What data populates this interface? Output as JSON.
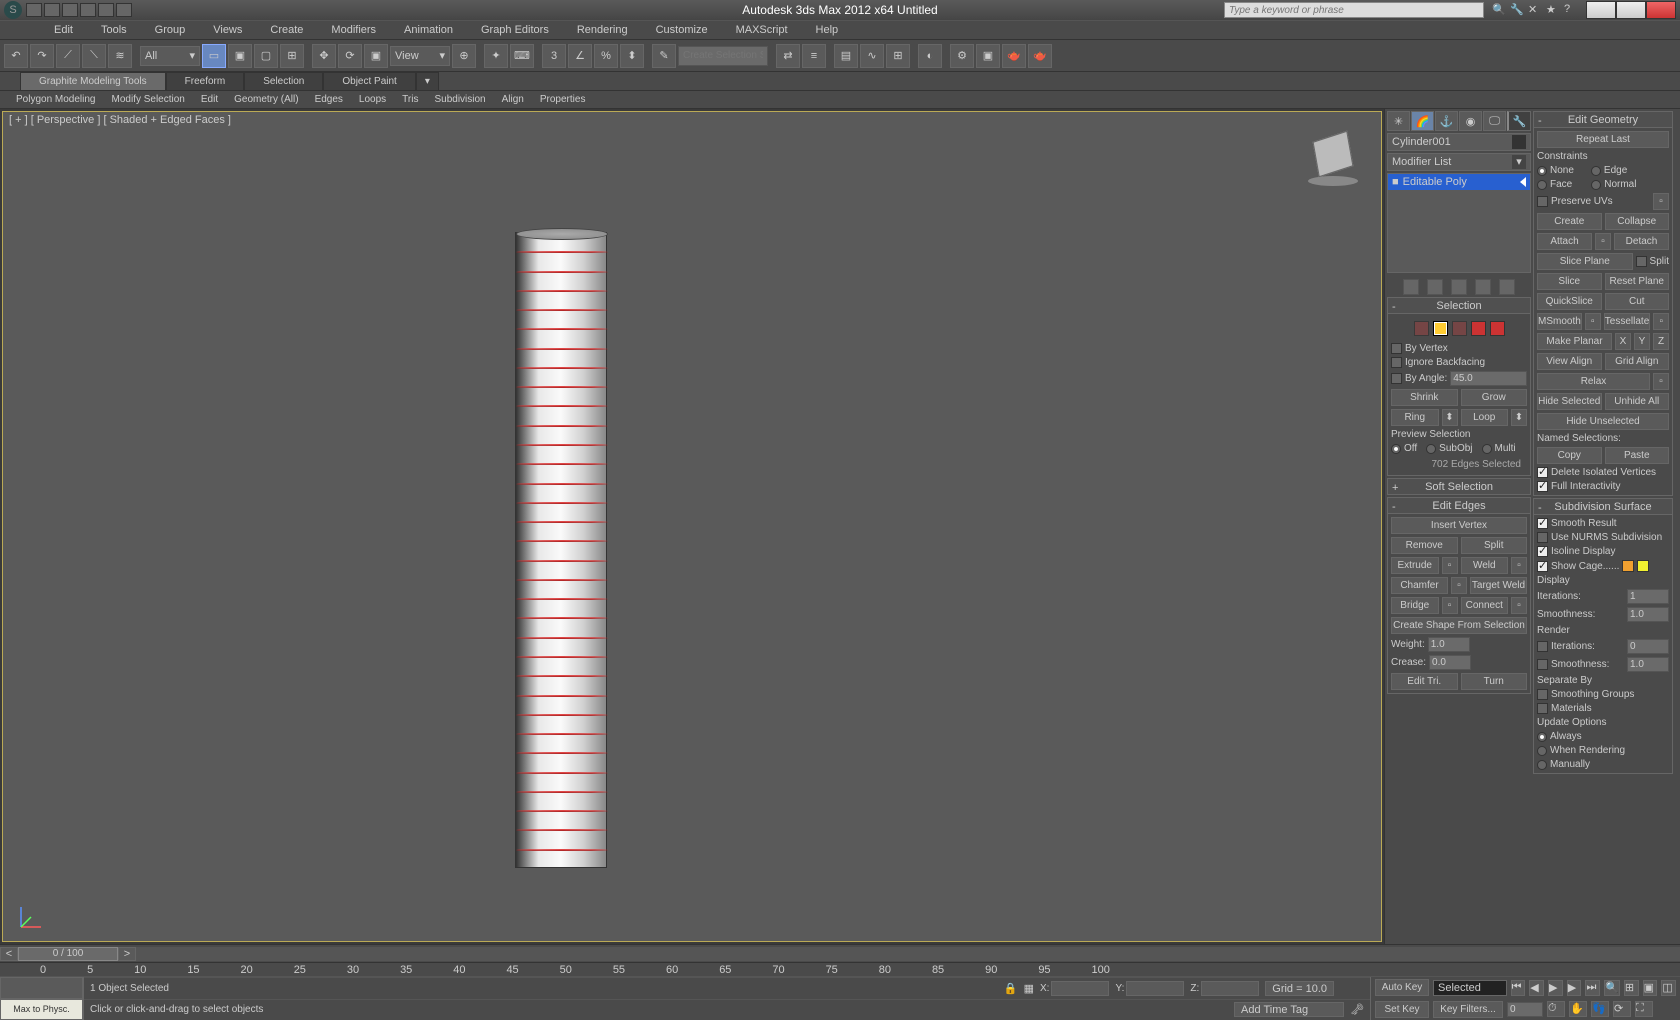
{
  "title": "Autodesk 3ds Max 2012 x64     Untitled",
  "search_placeholder": "Type a keyword or phrase",
  "menu": [
    "Edit",
    "Tools",
    "Group",
    "Views",
    "Create",
    "Modifiers",
    "Animation",
    "Graph Editors",
    "Rendering",
    "Customize",
    "MAXScript",
    "Help"
  ],
  "toolbar": {
    "filter_dd": "All",
    "view_dd": "View",
    "create_sel": "Create Selection Se"
  },
  "ribbon_tabs": [
    "Graphite Modeling Tools",
    "Freeform",
    "Selection",
    "Object Paint"
  ],
  "ribbon_sub": [
    "Polygon Modeling",
    "Modify Selection",
    "Edit",
    "Geometry (All)",
    "Edges",
    "Loops",
    "Tris",
    "Subdivision",
    "Align",
    "Properties"
  ],
  "viewport_label": "[ + ] [ Perspective ] [ Shaded + Edged Faces ]",
  "object_name": "Cylinder001",
  "modifier_list_label": "Modifier List",
  "modifier_stack_item": "Editable Poly",
  "selection": {
    "header": "Selection",
    "by_vertex": "By Vertex",
    "ignore_backfacing": "Ignore Backfacing",
    "by_angle": "By Angle:",
    "by_angle_val": "45.0",
    "shrink": "Shrink",
    "grow": "Grow",
    "ring": "Ring",
    "loop": "Loop",
    "preview": "Preview Selection",
    "off": "Off",
    "subobj": "SubObj",
    "multi": "Multi",
    "status": "702 Edges Selected"
  },
  "soft_sel_header": "Soft Selection",
  "edit_edges": {
    "header": "Edit Edges",
    "insert_vertex": "Insert Vertex",
    "remove": "Remove",
    "split": "Split",
    "extrude": "Extrude",
    "weld": "Weld",
    "chamfer": "Chamfer",
    "target_weld": "Target Weld",
    "bridge": "Bridge",
    "connect": "Connect",
    "create_shape": "Create Shape From Selection",
    "weight": "Weight:",
    "weight_val": "1.0",
    "crease": "Crease:",
    "crease_val": "0.0",
    "edit_tri": "Edit Tri.",
    "turn": "Turn"
  },
  "edit_geom": {
    "header": "Edit Geometry",
    "repeat": "Repeat Last",
    "constraints": "Constraints",
    "none": "None",
    "edge": "Edge",
    "face": "Face",
    "normal": "Normal",
    "preserve_uvs": "Preserve UVs",
    "create": "Create",
    "collapse": "Collapse",
    "attach": "Attach",
    "detach": "Detach",
    "slice_plane": "Slice Plane",
    "split": "Split",
    "slice": "Slice",
    "reset_plane": "Reset Plane",
    "quickslice": "QuickSlice",
    "cut": "Cut",
    "msmooth": "MSmooth",
    "tessellate": "Tessellate",
    "make_planar": "Make Planar",
    "x": "X",
    "y": "Y",
    "z": "Z",
    "view_align": "View Align",
    "grid_align": "Grid Align",
    "relax": "Relax",
    "hide_sel": "Hide Selected",
    "unhide_all": "Unhide All",
    "hide_unsel": "Hide Unselected",
    "named_sel": "Named Selections:",
    "copy": "Copy",
    "paste": "Paste",
    "del_iso": "Delete Isolated Vertices",
    "full_int": "Full Interactivity"
  },
  "subdiv": {
    "header": "Subdivision Surface",
    "smooth": "Smooth Result",
    "nurms": "Use NURMS Subdivision",
    "isoline": "Isoline Display",
    "show_cage": "Show Cage......",
    "display": "Display",
    "iterations": "Iterations:",
    "iter_val": "1",
    "smoothness": "Smoothness:",
    "smooth_val": "1.0",
    "render": "Render",
    "r_iter_val": "0",
    "r_smooth_val": "1.0",
    "separate": "Separate By",
    "smoothing_groups": "Smoothing Groups",
    "materials": "Materials",
    "update": "Update Options",
    "always": "Always",
    "rendering": "When Rendering",
    "manually": "Manually"
  },
  "timeslider": "0 / 100",
  "trackbar_ticks": [
    "0",
    "5",
    "10",
    "15",
    "20",
    "25",
    "30",
    "35",
    "40",
    "45",
    "50",
    "55",
    "60",
    "65",
    "70",
    "75",
    "80",
    "85",
    "90",
    "95",
    "100"
  ],
  "status_bar": {
    "sel": "1 Object Selected",
    "prompt": "Click or click-and-drag to select objects",
    "x": "X:",
    "y": "Y:",
    "z": "Z:",
    "grid": "Grid = 10.0",
    "add_tag": "Add Time Tag"
  },
  "anim_controls": {
    "autokey": "Auto Key",
    "setkey": "Set Key",
    "selected": "Selected",
    "keyfilters": "Key Filters..."
  },
  "max_to_physc": "Max to Physc."
}
